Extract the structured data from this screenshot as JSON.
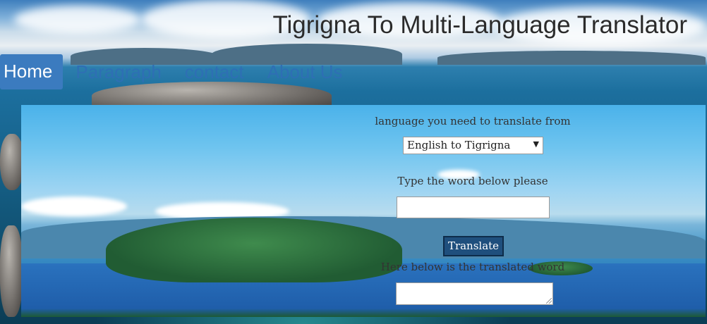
{
  "header": {
    "title": "Tigrigna To Multi-Language Translator"
  },
  "nav": {
    "items": [
      {
        "label": "Home",
        "active": true
      },
      {
        "label": "Paragraph",
        "active": false
      },
      {
        "label": "contact",
        "active": false
      },
      {
        "label": "About Us",
        "active": false
      }
    ]
  },
  "form": {
    "from_label": "language you need to translate from",
    "language_select": {
      "selected": "English to Tigrigna"
    },
    "word_label": "Type the word below please",
    "word_input": {
      "value": "",
      "placeholder": ""
    },
    "translate_button": "Translate",
    "result_label": "Here below is the translated word",
    "result_box": {
      "value": ""
    }
  },
  "icons": {
    "select_arrow": "dropdown-arrow-icon"
  },
  "colors": {
    "nav_active_bg": "#3b7bbf",
    "nav_link": "#2e6fb4",
    "button_bg": "#1f4f7d",
    "title_text": "#2b2b2b"
  }
}
